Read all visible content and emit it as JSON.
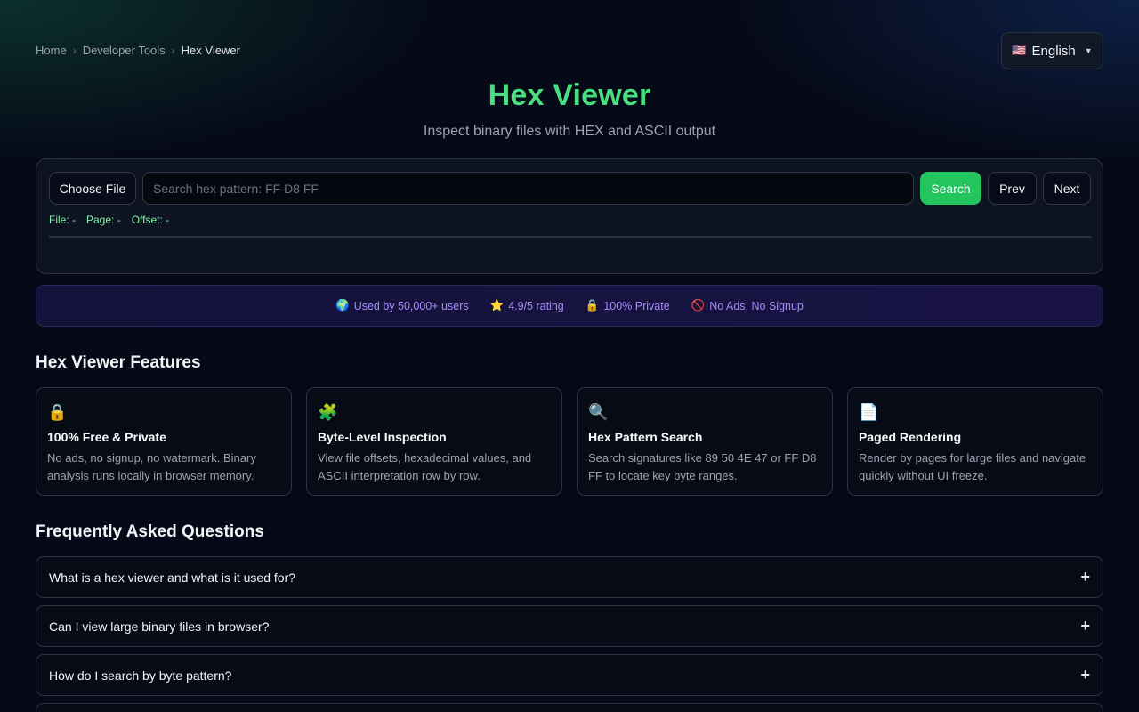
{
  "breadcrumb": {
    "home": "Home",
    "section": "Developer Tools",
    "current": "Hex Viewer",
    "separator": "›"
  },
  "language": {
    "flag": "🇺🇸",
    "label": "English",
    "caret": "▼"
  },
  "header": {
    "title": "Hex Viewer",
    "subtitle": "Inspect binary files with HEX and ASCII output"
  },
  "toolbar": {
    "choose_file": "Choose File",
    "search_placeholder": "Search hex pattern: FF D8 FF",
    "search_value": "",
    "search_label": "Search",
    "prev_label": "Prev",
    "next_label": "Next"
  },
  "status": {
    "file": "File: -",
    "page": "Page: -",
    "offset": "Offset: -"
  },
  "trust": [
    {
      "icon": "🌍",
      "text": "Used by 50,000+ users"
    },
    {
      "icon": "⭐",
      "text": "4.9/5 rating"
    },
    {
      "icon": "🔒",
      "text": "100% Private"
    },
    {
      "icon": "🚫",
      "text": "No Ads, No Signup"
    }
  ],
  "features": {
    "heading": "Hex Viewer Features",
    "items": [
      {
        "icon": "🔒",
        "title": "100% Free & Private",
        "desc": "No ads, no signup, no watermark. Binary analysis runs locally in browser memory."
      },
      {
        "icon": "🧩",
        "title": "Byte-Level Inspection",
        "desc": "View file offsets, hexadecimal values, and ASCII interpretation row by row."
      },
      {
        "icon": "🔍",
        "title": "Hex Pattern Search",
        "desc": "Search signatures like 89 50 4E 47 or FF D8 FF to locate key byte ranges."
      },
      {
        "icon": "📄",
        "title": "Paged Rendering",
        "desc": "Render by pages for large files and navigate quickly without UI freeze."
      }
    ]
  },
  "faq": {
    "heading": "Frequently Asked Questions",
    "toggle": "+",
    "items": [
      {
        "q": "What is a hex viewer and what is it used for?"
      },
      {
        "q": "Can I view large binary files in browser?"
      },
      {
        "q": "How do I search by byte pattern?"
      }
    ]
  }
}
